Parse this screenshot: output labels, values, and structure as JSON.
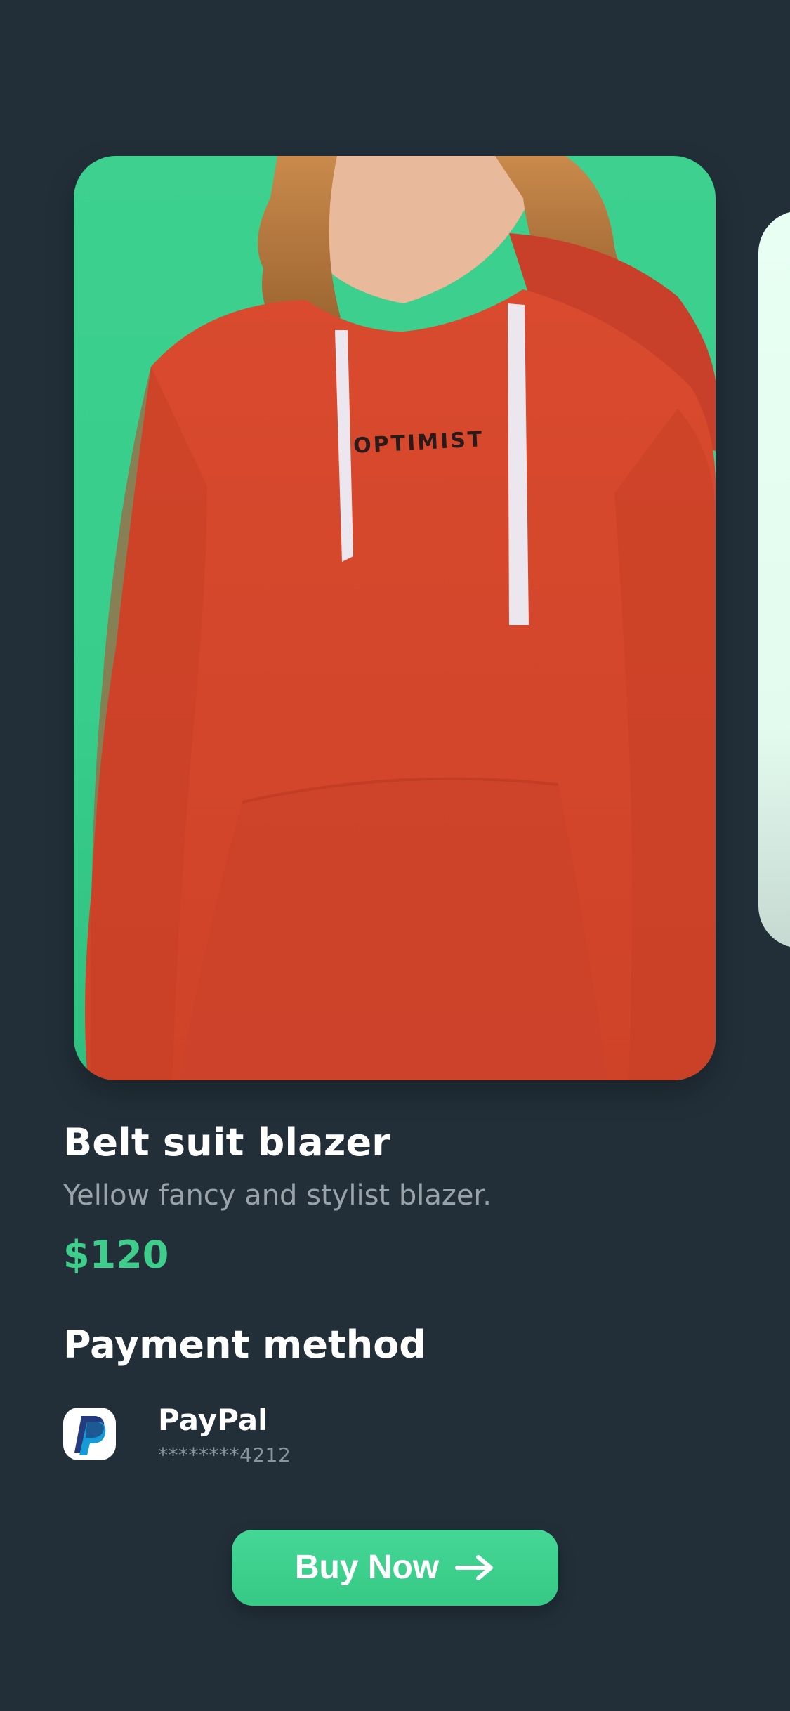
{
  "product": {
    "image": {
      "subject": "model wearing red hoodie",
      "print_text": "OPTIMIST",
      "background_color": "#3dd08f",
      "garment_color": "#d5452b"
    },
    "title": "Belt suit blazer",
    "description": "Yellow fancy and stylist blazer.",
    "price": "$120"
  },
  "payment": {
    "section_title": "Payment method",
    "method": {
      "icon": "paypal-icon",
      "name": "PayPal",
      "masked_number": "********4212"
    }
  },
  "actions": {
    "buy_label": "Buy Now",
    "buy_icon": "arrow-right-icon"
  },
  "colors": {
    "background": "#222f39",
    "accent": "#3ecd8b",
    "muted_text": "#9aa3aa"
  }
}
